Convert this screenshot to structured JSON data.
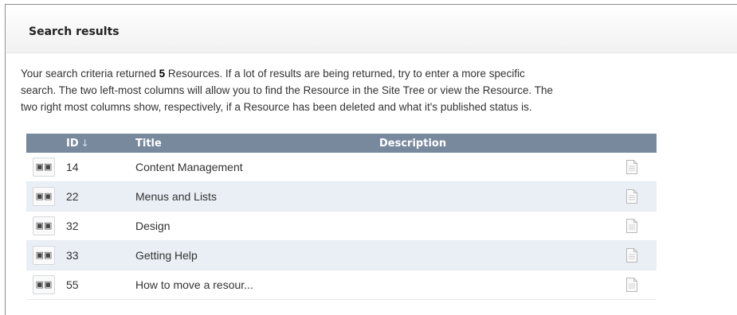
{
  "panel": {
    "title": "Search results"
  },
  "description": {
    "part1": "Your search criteria returned ",
    "count": "5",
    "part2": " Resources. If a lot of results are being returned, try to enter a more specific",
    "line2": "search. The two left-most columns will allow you to find the Resource in the Site Tree or view the Resource. The",
    "line3": "two right most columns show, respectively, if a Resource has been deleted and what it's published status is."
  },
  "table": {
    "headers": {
      "id": "ID",
      "sort_arrow": "↓",
      "title": "Title",
      "description": "Description"
    },
    "rows": [
      {
        "id": "14",
        "title": "Content Management",
        "description": ""
      },
      {
        "id": "22",
        "title": "Menus and Lists",
        "description": ""
      },
      {
        "id": "32",
        "title": "Design",
        "description": ""
      },
      {
        "id": "33",
        "title": "Getting Help",
        "description": ""
      },
      {
        "id": "55",
        "title": "How to move a resour...",
        "description": ""
      }
    ]
  },
  "icons": {
    "view": "binoculars-icon",
    "published": "document-icon"
  },
  "colors": {
    "header_bg": "#78899e",
    "alt_row_bg": "#e9eff5"
  }
}
